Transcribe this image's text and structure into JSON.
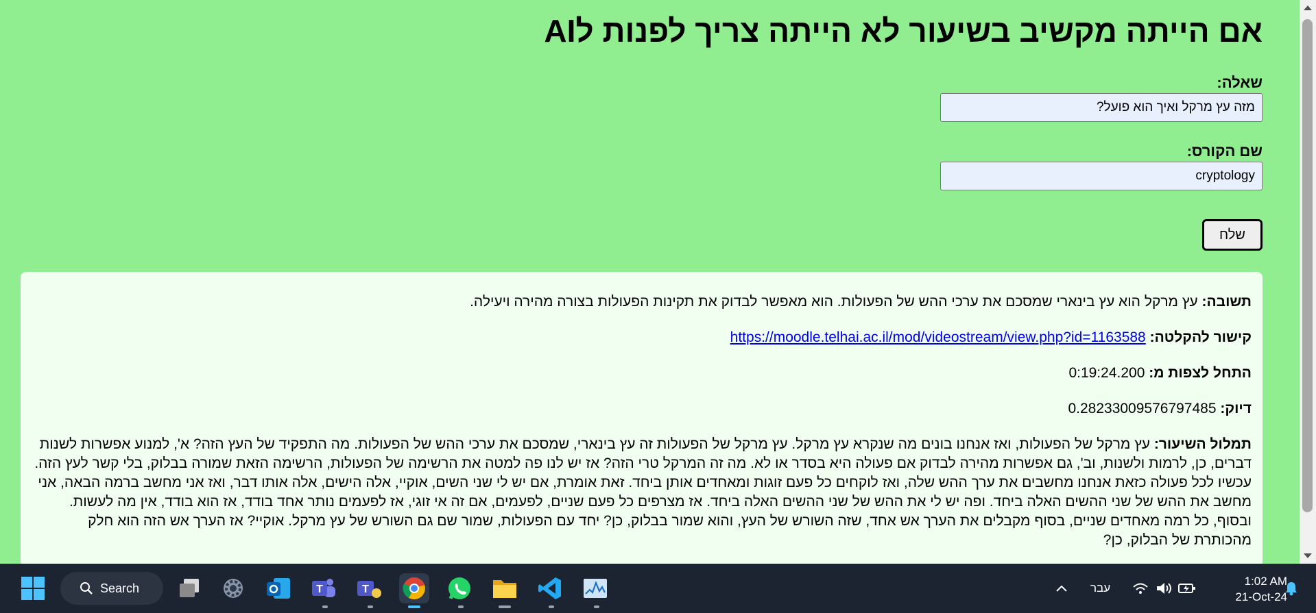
{
  "page": {
    "title": "אם הייתה מקשיב בשיעור לא הייתה צריך לפנות לAI",
    "question_label": "שאלה:",
    "question_value": "מזה עץ מרקל ואיך הוא פועל?",
    "course_label": "שם הקורס:",
    "course_value": "cryptology",
    "send_label": "שלח"
  },
  "result": {
    "answer_label": "תשובה:",
    "answer_text": "עץ מרקל הוא עץ בינארי שמסכם את ערכי ההש של הפעולות. הוא מאפשר לבדוק את תקינות הפעולות בצורה מהירה ויעילה.",
    "link_label": "קישור להקלטה:",
    "link_url": "https://moodle.telhai.ac.il/mod/videostream/view.php?id=1163588",
    "start_label": "התחל לצפות מ:",
    "start_value": "0:19:24.200",
    "accuracy_label": "דיוק:",
    "accuracy_value": "0.28233009576797485",
    "transcript_label": "תמלול השיעור:",
    "transcript_text": "עץ מרקל של הפעולות, ואז אנחנו בונים מה שנקרא עץ מרקל. עץ מרקל של הפעולות זה עץ בינארי, שמסכם את ערכי ההש של הפעולות. מה התפקיד של העץ הזה? א', למנוע אפשרות לשנות דברים, כן, לרמות ולשנות, וב', גם אפשרות מהירה לבדוק אם פעולה היא בסדר או לא. מה זה המרקל טרי הזה? אז יש לנו פה למטה את הרשימה של הפעולות, הרשימה הזאת שמורה בבלוק, בלי קשר לעץ הזה. עכשיו לכל פעולה כזאת אנחנו מחשבים את ערך ההש שלה, ואז לוקחים כל פעם זוגות ומאחדים אותן ביחד. זאת אומרת, אם יש לי שני השים, אוקיי, אלה הישים, אלה אותו דבר, ואז אני מחשב ברמה הבאה, אני מחשב את ההש של שני ההשים האלה ביחד. ופה יש לי את ההש של שני ההשים האלה ביחד. אז מצרפים כל פעם שניים, לפעמים, אם זה אי זוגי, אז לפעמים נותר אחד בודד, אז הוא בודד, אין מה לעשות. ובסוף, כל רמה מאחדים שניים, בסוף מקבלים את הערך אש אחד, שזה השורש של העץ, והוא שמור בבלוק, כן? יחד עם הפעולות, שמור שם גם השורש של עץ מרקל. אוקיי? אז הערך אש הזה הוא חלק מהכותרת של הבלוק, כן?"
  },
  "taskbar": {
    "search_label": "Search",
    "language": "עבר",
    "time": "1:02 AM",
    "date": "21-Oct-24",
    "icons": [
      "windows-start-icon",
      "task-view-icon",
      "settings-icon",
      "outlook-icon",
      "teams-icon",
      "teams-personal-icon",
      "chrome-icon",
      "whatsapp-icon",
      "file-explorer-icon",
      "vscode-icon",
      "task-manager-icon"
    ]
  },
  "colors": {
    "background": "#90ee90",
    "result_background": "#f0fff0",
    "input_background": "#e8f0fe",
    "link": "#0000ee",
    "taskbar": "#1c2432"
  }
}
